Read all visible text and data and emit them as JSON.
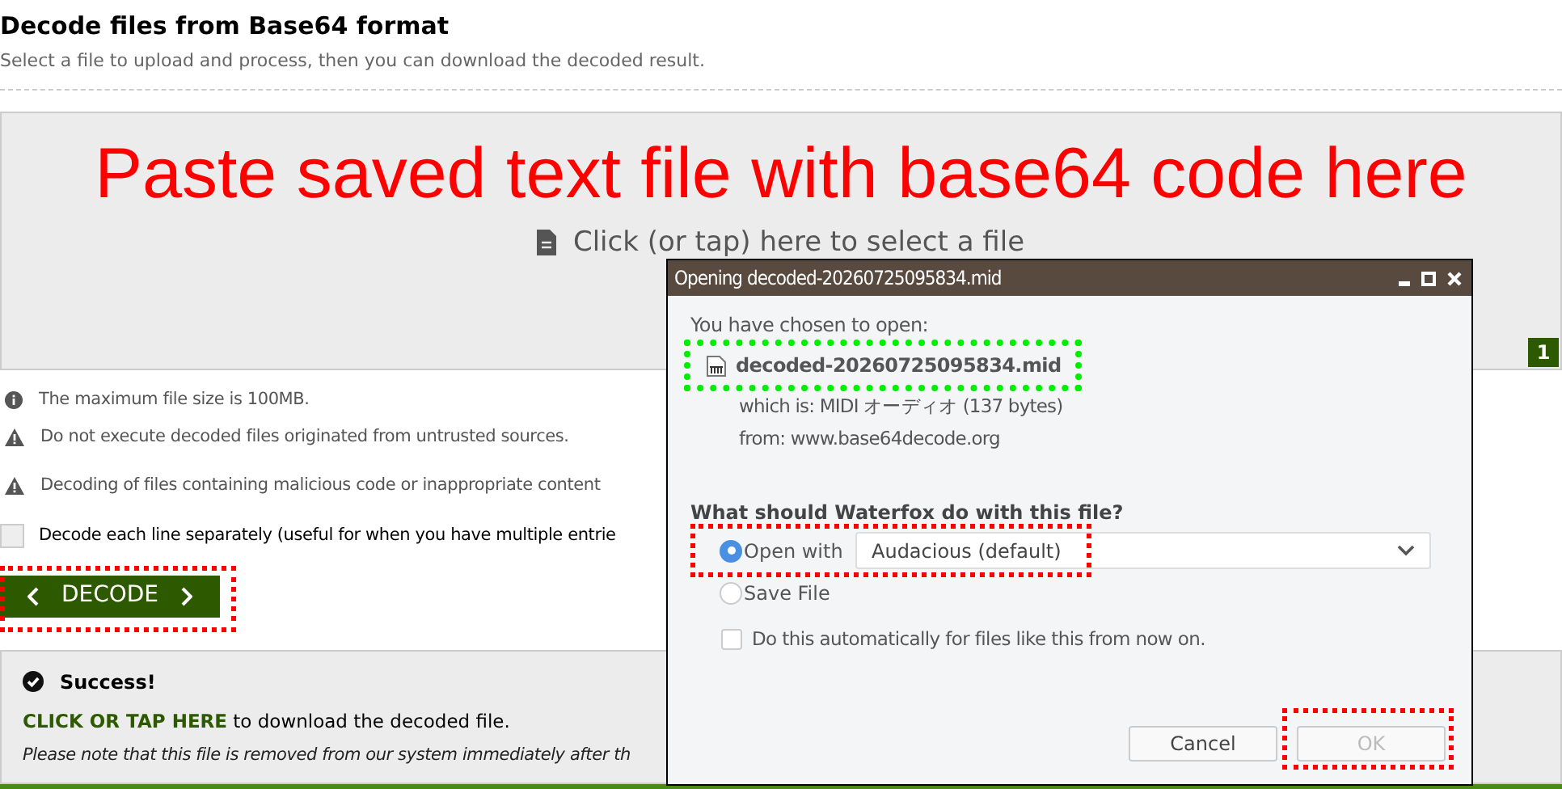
{
  "page": {
    "title": "Decode files from Base64 format",
    "subtitle": "Select a file to upload and process, then you can download the decoded result."
  },
  "dropzone": {
    "overlay_text": "Paste saved text file with base64 code here",
    "prompt": "Click (or tap) here to select a file",
    "badge": "1"
  },
  "notes": [
    {
      "kind": "info",
      "text": "The maximum file size is 100MB."
    },
    {
      "kind": "warning",
      "text": "Do not execute decoded files originated from untrusted sources."
    },
    {
      "kind": "warning",
      "text": "Decoding of files containing malicious code or inappropriate content"
    }
  ],
  "option": {
    "label": "Decode each line separately (useful for when you have multiple entrie",
    "checked": false
  },
  "decode_button": {
    "label": "DECODE",
    "highlight": {
      "color": "#ff0000"
    }
  },
  "result": {
    "title": "Success!",
    "link": "CLICK OR TAP HERE",
    "link_suffix": " to download the decoded file.",
    "note": "Please note that this file is removed from our system immediately after th"
  },
  "dialog": {
    "title": "Opening decoded-20260725095834.mid",
    "intro": "You have chosen to open:",
    "file_name": "decoded-20260725095834.mid",
    "file_highlight": {
      "color": "#00ee00"
    },
    "type_line": "which is: MIDI オーディオ (137 bytes)",
    "from_line": "from: www.base64decode.org",
    "question": "What should Waterfox do with this file?",
    "choices": [
      {
        "kind": "open",
        "label": "Open with",
        "selected": true,
        "app": "Audacious (default)",
        "highlight": {
          "color": "#ff0000"
        }
      },
      {
        "kind": "save",
        "label": "Save File",
        "selected": false
      }
    ],
    "auto": {
      "label": "Do this automatically for files like this from now on.",
      "checked": false
    },
    "buttons": [
      {
        "label": "Cancel",
        "disabled": false
      },
      {
        "label": "OK",
        "disabled": true,
        "highlight": {
          "color": "#ff0000"
        }
      }
    ]
  }
}
